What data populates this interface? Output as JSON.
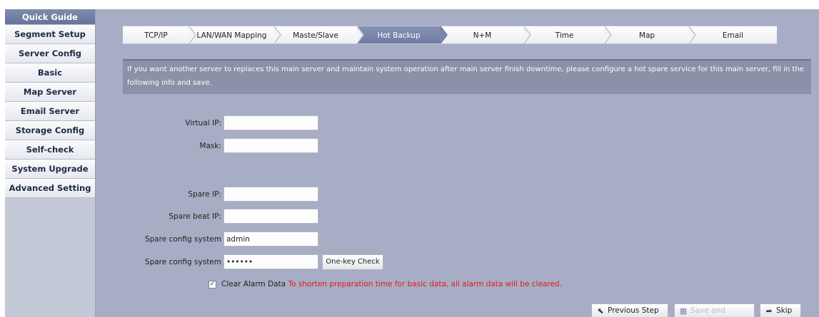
{
  "sidebar": {
    "items": [
      {
        "label": "Quick Guide",
        "active": true
      },
      {
        "label": "Segment Setup"
      },
      {
        "label": "Server Config"
      },
      {
        "label": "Basic"
      },
      {
        "label": "Map Server"
      },
      {
        "label": "Email Server"
      },
      {
        "label": "Storage Config"
      },
      {
        "label": "Self-check"
      },
      {
        "label": "System Upgrade"
      },
      {
        "label": "Advanced Setting"
      }
    ]
  },
  "steps": [
    {
      "label": "TCP/IP"
    },
    {
      "label": "LAN/WAN Mapping"
    },
    {
      "label": "Maste/Slave"
    },
    {
      "label": "Hot Backup",
      "active": true
    },
    {
      "label": "N+M"
    },
    {
      "label": "Time"
    },
    {
      "label": "Map"
    },
    {
      "label": "Email"
    }
  ],
  "banner": {
    "text": "If you want another server to replaces this main server and maintain system operation after main server finish downtime, please configure a hot spare service for this main server, fill in the following info and save."
  },
  "form": {
    "virtual_ip": {
      "label": "Virtual IP:",
      "value": ""
    },
    "mask": {
      "label": "Mask:",
      "value": ""
    },
    "spare_ip": {
      "label": "Spare IP:",
      "value": ""
    },
    "spare_beat_ip": {
      "label": "Spare beat IP:",
      "value": ""
    },
    "spare_config_user": {
      "label": "Spare config system",
      "value": "admin"
    },
    "spare_config_pass": {
      "label": "Spare config system",
      "value": "••••••"
    },
    "one_key_check": "One-key Check",
    "clear_alarm": {
      "checked": true,
      "label": "Clear Alarm Data",
      "warning": "To shorten preparation time for basic data, all alarm data will be cleared."
    }
  },
  "footer": {
    "previous_step": "Previous Step",
    "save_reboot": "Save and Reboot",
    "skip": "Skip"
  },
  "icons": {
    "previous": "back-arrow-icon",
    "save": "calendar-save-icon",
    "skip": "skip-arrow-icon"
  },
  "colors": {
    "accent": "#6f7ca1",
    "warning": "#e21b1b"
  }
}
